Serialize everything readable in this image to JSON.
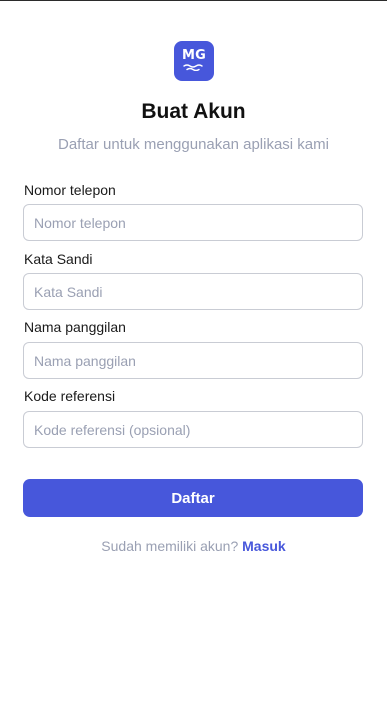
{
  "logo": {
    "text": "MG",
    "background": "#4757db"
  },
  "header": {
    "title": "Buat Akun",
    "subtitle": "Daftar untuk menggunakan aplikasi kami"
  },
  "form": {
    "phone": {
      "label": "Nomor telepon",
      "placeholder": "Nomor telepon",
      "value": ""
    },
    "password": {
      "label": "Kata Sandi",
      "placeholder": "Kata Sandi",
      "value": ""
    },
    "nickname": {
      "label": "Nama panggilan",
      "placeholder": "Nama panggilan",
      "value": ""
    },
    "referral": {
      "label": "Kode referensi",
      "placeholder": "Kode referensi (opsional)",
      "value": ""
    },
    "submit_label": "Daftar"
  },
  "footer": {
    "prompt": "Sudah memiliki akun?",
    "link_label": "Masuk"
  },
  "colors": {
    "accent": "#4757db",
    "muted_text": "#9aa0b3",
    "border": "#c9ccd4"
  }
}
